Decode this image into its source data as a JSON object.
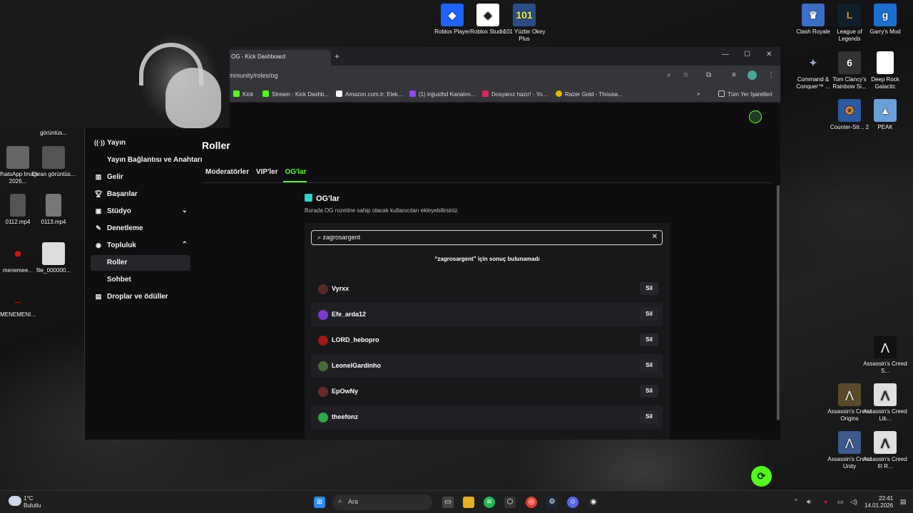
{
  "desktop": {
    "top_icons": [
      {
        "label": "Roblox Player",
        "icon": "roblox-player-icon",
        "color": "#1e63ff"
      },
      {
        "label": "Roblox Studio",
        "icon": "roblox-studio-icon",
        "color": "#ffffff"
      },
      {
        "label": "101 Yüzbir Okey Plus",
        "icon": "okey-plus-icon",
        "color": "#2a4d8a"
      }
    ],
    "right_icons": [
      {
        "label": "Clash Royale",
        "icon": "clash-royale-icon",
        "color": "#3b6fc5"
      },
      {
        "label": "League of Legends",
        "icon": "league-of-legends-icon",
        "color": "#c9a24a"
      },
      {
        "label": "Garry's Mod",
        "icon": "garrys-mod-icon",
        "color": "#1b6fd1"
      },
      {
        "label": "Command & Conquer™ ...",
        "icon": "command-conquer-icon",
        "color": "#3a4b7a"
      },
      {
        "label": "Tom Clancy's Rainbow Si...",
        "icon": "rainbow-six-icon",
        "color": "#333333"
      },
      {
        "label": "Deep Rock Galactic",
        "icon": "file-icon",
        "color": "#ffffff"
      },
      {
        "label": "Counter-Str... 2",
        "icon": "counter-strike-icon",
        "color": "#2a5aa0"
      },
      {
        "label": "PEAK",
        "icon": "peak-icon",
        "color": "#6aa0d8"
      },
      {
        "label": "Assassin's Creed S...",
        "icon": "assassins-creed-icon",
        "color": "#1a1a1a"
      },
      {
        "label": "Assassin's Creed Origins",
        "icon": "assassins-creed-icon",
        "color": "#5a4a2a"
      },
      {
        "label": "Assassin's Creed Lib...",
        "icon": "assassins-creed-icon",
        "color": "#e0e0e0"
      },
      {
        "label": "Assassin's Creed Unity",
        "icon": "assassins-creed-icon",
        "color": "#3c5a8a"
      },
      {
        "label": "Assassin's Creed III R...",
        "icon": "assassins-creed-icon",
        "color": "#e0e0e0"
      }
    ],
    "left_icons": [
      {
        "label": "görüntüs...",
        "icon": "image-icon",
        "color": "#444444"
      },
      {
        "label": "WhatsApp Image 2026...",
        "icon": "image-icon",
        "color": "#666666"
      },
      {
        "label": "Ekran görüntüs...",
        "icon": "image-icon",
        "color": "#555555"
      },
      {
        "label": "0112.mp4",
        "icon": "video-icon",
        "color": "#555555"
      },
      {
        "label": "0113.mp4",
        "icon": "video-icon",
        "color": "#777777"
      },
      {
        "label": "menemee...",
        "icon": "tomato-icon",
        "color": "#d01010"
      },
      {
        "label": "file_000000...",
        "icon": "image-icon",
        "color": "#dddddd"
      },
      {
        "label": "MENEMENI...",
        "icon": "logo-icon",
        "color": "#aa1010"
      }
    ]
  },
  "browser": {
    "tab_title": "OG - Kick Dashboard",
    "url": "mmunity/roles/og",
    "bookmarks": [
      {
        "label": "Kick",
        "color": "#53fc18"
      },
      {
        "label": "Stream - Kick Dashb...",
        "color": "#53fc18"
      },
      {
        "label": "Amazon.com.tr: Elek...",
        "color": "#ffffff"
      },
      {
        "label": "(1) injjusthd Kanalını...",
        "color": "#9146ff"
      },
      {
        "label": "Dosyanız hazır! - Yo...",
        "color": "#e0245e"
      },
      {
        "label": "Razer Gold - Thousa...",
        "color": "#e5b800"
      }
    ],
    "bookmarks_more": "»",
    "all_bookmarks": "Tüm Yer İşaretleri"
  },
  "sidebar": {
    "items": [
      {
        "label": "Yayın",
        "icon": "broadcast-icon"
      },
      {
        "label": "Yayın Bağlantısı ve Anahtarı",
        "icon": ""
      },
      {
        "label": "Gelir",
        "icon": "revenue-icon"
      },
      {
        "label": "Başarılar",
        "icon": "trophy-icon"
      },
      {
        "label": "Stüdyo",
        "icon": "studio-icon"
      },
      {
        "label": "Denetleme",
        "icon": "wrench-icon"
      },
      {
        "label": "Topluluk",
        "icon": "community-icon"
      },
      {
        "label": "Roller",
        "icon": ""
      },
      {
        "label": "Sohbet",
        "icon": ""
      },
      {
        "label": "Droplar ve ödüller",
        "icon": "gift-icon"
      }
    ]
  },
  "page": {
    "title": "Roller",
    "tabs": [
      "Moderatörler",
      "VIP'ler",
      "OG'lar"
    ],
    "active_tab": "OG'lar",
    "section_title": "OG'lar",
    "section_subtitle": "Burada OG rozetine sahip olacak kullanıcıları ekleyebilirsiniz.",
    "search_value": "zagrosargent",
    "no_result": "“zagrosargent” için sonuç bulunamadı",
    "remove_label": "Sil",
    "users": [
      {
        "name": "Vyrxx",
        "color": "#5a2a2a"
      },
      {
        "name": "Efe_arda12",
        "color": "#7a3ad0"
      },
      {
        "name": "LORD_hebopro",
        "color": "#a01818"
      },
      {
        "name": "LeonelGardinho",
        "color": "#4a6a3a"
      },
      {
        "name": "EpOwNy",
        "color": "#6a2a2a"
      },
      {
        "name": "theefonz",
        "color": "#2aa84a"
      }
    ]
  },
  "taskbar": {
    "weather_temp": "1°C",
    "weather_desc": "Bulutlu",
    "search_placeholder": "Ara",
    "time": "22:41",
    "date": "14.01.2026"
  },
  "accent": "#53fc18"
}
